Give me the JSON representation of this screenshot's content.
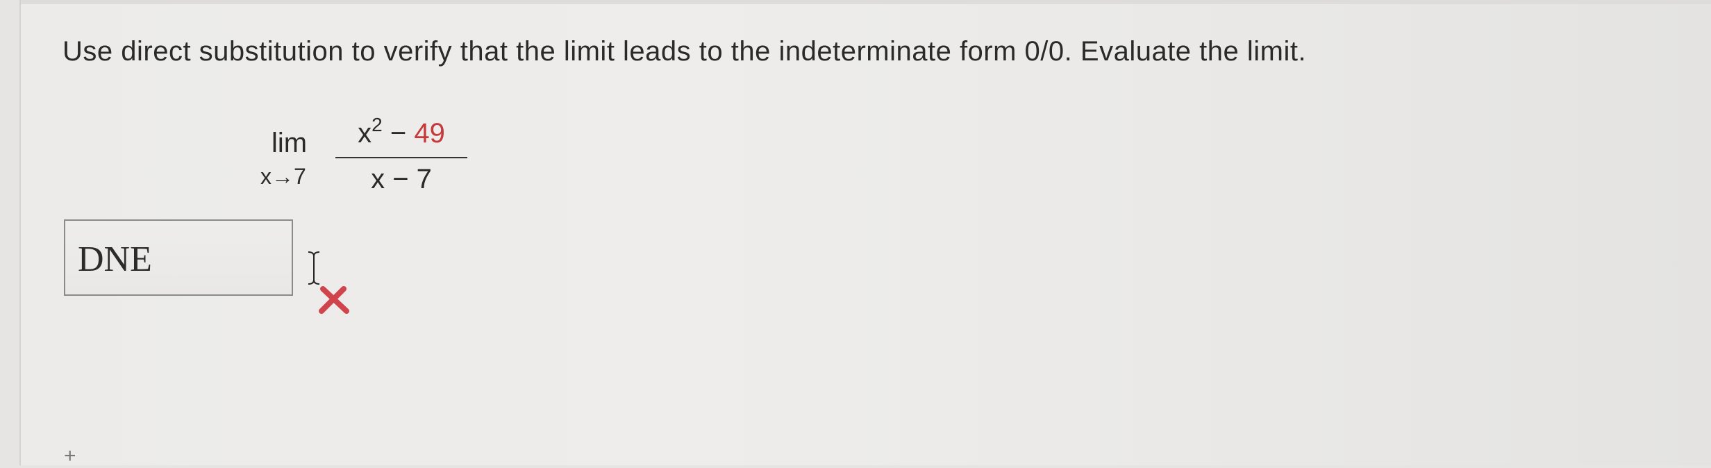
{
  "question": {
    "text": "Use direct substitution to verify that the limit leads to the indeterminate form 0/0. Evaluate the limit."
  },
  "expression": {
    "lim": "lim",
    "approach": "x→7",
    "numerator_base": "x",
    "numerator_exponent": "2",
    "numerator_op": " − ",
    "numerator_const": "49",
    "denominator": "x − 7"
  },
  "answer": {
    "value": "DNE",
    "status": "incorrect",
    "status_color": "#d0454c"
  },
  "icons": {
    "cursor": "text-cursor-icon",
    "status": "red-x-icon",
    "crosshair": "plus-icon"
  },
  "misc": {
    "plus": "+"
  }
}
